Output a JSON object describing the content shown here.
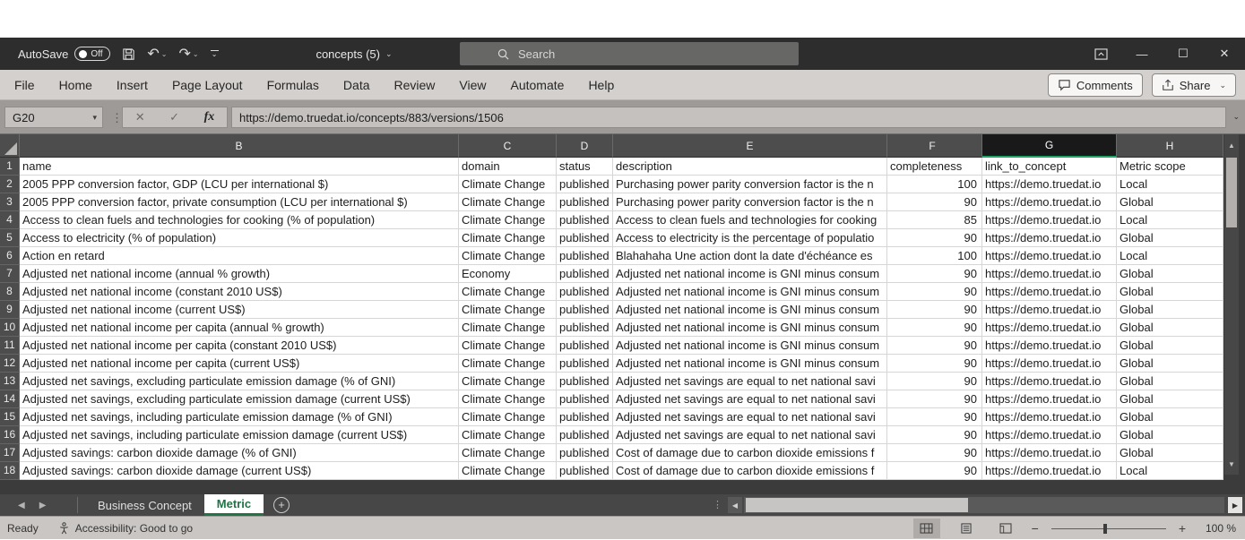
{
  "titlebar": {
    "autosave_label": "AutoSave",
    "autosave_state": "Off",
    "doc_title": "concepts (5)",
    "search_placeholder": "Search"
  },
  "ribbon": {
    "tabs": [
      "File",
      "Home",
      "Insert",
      "Page Layout",
      "Formulas",
      "Data",
      "Review",
      "View",
      "Automate",
      "Help"
    ],
    "comments_label": "Comments",
    "share_label": "Share"
  },
  "formula_bar": {
    "name_box": "G20",
    "cancel_glyph": "✕",
    "enter_glyph": "✓",
    "fx_label": "fx",
    "formula": "https://demo.truedat.io/concepts/883/versions/1506"
  },
  "sheet": {
    "selected_column": "G",
    "columns": [
      "B",
      "C",
      "D",
      "E",
      "F",
      "G",
      "H"
    ],
    "rows": [
      {
        "n": "1",
        "type": "header",
        "name": "name",
        "domain": "domain",
        "status": "status",
        "description": "description",
        "completeness": "completeness",
        "link": "link_to_concept",
        "scope": "Metric scope"
      },
      {
        "n": "2",
        "name": "2005 PPP conversion factor, GDP (LCU per international $)",
        "domain": "Climate Change",
        "status": "published",
        "description": "Purchasing power parity conversion factor is the n",
        "completeness": "100",
        "link": "https://demo.truedat.io",
        "scope": "Local"
      },
      {
        "n": "3",
        "name": "2005 PPP conversion factor, private consumption (LCU per international $)",
        "domain": "Climate Change",
        "status": "published",
        "description": "Purchasing power parity conversion factor is the n",
        "completeness": "90",
        "link": "https://demo.truedat.io",
        "scope": "Global"
      },
      {
        "n": "4",
        "name": "Access to clean fuels and technologies for cooking (% of population)",
        "domain": "Climate Change",
        "status": "published",
        "description": "Access to clean fuels and technologies for cooking",
        "completeness": "85",
        "link": "https://demo.truedat.io",
        "scope": "Local"
      },
      {
        "n": "5",
        "name": "Access to electricity (% of population)",
        "domain": "Climate Change",
        "status": "published",
        "description": "Access to electricity is the percentage of populatio",
        "completeness": "90",
        "link": "https://demo.truedat.io",
        "scope": "Global"
      },
      {
        "n": "6",
        "name": "Action en retard",
        "domain": "Climate Change",
        "status": "published",
        "description": "Blahahaha  Une action dont la date d'échéance es",
        "completeness": "100",
        "link": "https://demo.truedat.io",
        "scope": "Local"
      },
      {
        "n": "7",
        "name": "Adjusted net national income (annual % growth)",
        "domain": "Economy",
        "status": "published",
        "description": "Adjusted net national income is GNI minus consum",
        "completeness": "90",
        "link": "https://demo.truedat.io",
        "scope": "Global"
      },
      {
        "n": "8",
        "name": "Adjusted net national income (constant 2010 US$)",
        "domain": "Climate Change",
        "status": "published",
        "description": "Adjusted net national income is GNI minus consum",
        "completeness": "90",
        "link": "https://demo.truedat.io",
        "scope": "Global"
      },
      {
        "n": "9",
        "name": "Adjusted net national income (current US$)",
        "domain": "Climate Change",
        "status": "published",
        "description": "Adjusted net national income is GNI minus consum",
        "completeness": "90",
        "link": "https://demo.truedat.io",
        "scope": "Global"
      },
      {
        "n": "10",
        "name": "Adjusted net national income per capita (annual % growth)",
        "domain": "Climate Change",
        "status": "published",
        "description": "Adjusted net national income is GNI minus consum",
        "completeness": "90",
        "link": "https://demo.truedat.io",
        "scope": "Global"
      },
      {
        "n": "11",
        "name": "Adjusted net national income per capita (constant 2010 US$)",
        "domain": "Climate Change",
        "status": "published",
        "description": "Adjusted net national income is GNI minus consum",
        "completeness": "90",
        "link": "https://demo.truedat.io",
        "scope": "Global"
      },
      {
        "n": "12",
        "name": "Adjusted net national income per capita (current US$)",
        "domain": "Climate Change",
        "status": "published",
        "description": "Adjusted net national income is GNI minus consum",
        "completeness": "90",
        "link": "https://demo.truedat.io",
        "scope": "Global"
      },
      {
        "n": "13",
        "name": "Adjusted net savings, excluding particulate emission damage (% of GNI)",
        "domain": "Climate Change",
        "status": "published",
        "description": "Adjusted net savings are equal to net national savi",
        "completeness": "90",
        "link": "https://demo.truedat.io",
        "scope": "Global"
      },
      {
        "n": "14",
        "name": "Adjusted net savings, excluding particulate emission damage (current US$)",
        "domain": "Climate Change",
        "status": "published",
        "description": "Adjusted net savings are equal to net national savi",
        "completeness": "90",
        "link": "https://demo.truedat.io",
        "scope": "Global"
      },
      {
        "n": "15",
        "name": "Adjusted net savings, including particulate emission damage (% of GNI)",
        "domain": "Climate Change",
        "status": "published",
        "description": "Adjusted net savings are equal to net national savi",
        "completeness": "90",
        "link": "https://demo.truedat.io",
        "scope": "Global"
      },
      {
        "n": "16",
        "name": "Adjusted net savings, including particulate emission damage (current US$)",
        "domain": "Climate Change",
        "status": "published",
        "description": "Adjusted net savings are equal to net national savi",
        "completeness": "90",
        "link": "https://demo.truedat.io",
        "scope": "Global"
      },
      {
        "n": "17",
        "name": "Adjusted savings: carbon dioxide damage (% of GNI)",
        "domain": "Climate Change",
        "status": "published",
        "description": "Cost of damage due to carbon dioxide emissions f",
        "completeness": "90",
        "link": "https://demo.truedat.io",
        "scope": "Global"
      },
      {
        "n": "18",
        "name": "Adjusted savings: carbon dioxide damage (current US$)",
        "domain": "Climate Change",
        "status": "published",
        "description": "Cost of damage due to carbon dioxide emissions f",
        "completeness": "90",
        "link": "https://demo.truedat.io",
        "scope": "Local"
      }
    ]
  },
  "sheet_tabs": {
    "items": [
      {
        "label": "Business Concept"
      },
      {
        "label": "Metric"
      }
    ],
    "active": "Metric",
    "add_glyph": "+"
  },
  "status_bar": {
    "mode": "Ready",
    "accessibility": "Accessibility: Good to go",
    "zoom_level": "100 %",
    "zoom_minus": "−",
    "zoom_plus": "+"
  },
  "icons": {
    "undo": "↶",
    "redo": "↷",
    "dropdown_chevron": "⌄",
    "namebox_arrow": "▾",
    "minimize": "—",
    "maximize": "☐",
    "close": "✕",
    "nav_left": "◀",
    "nav_right": "▶",
    "scroll_up": "▲",
    "scroll_down": "▼",
    "more_dots": "⋮"
  }
}
